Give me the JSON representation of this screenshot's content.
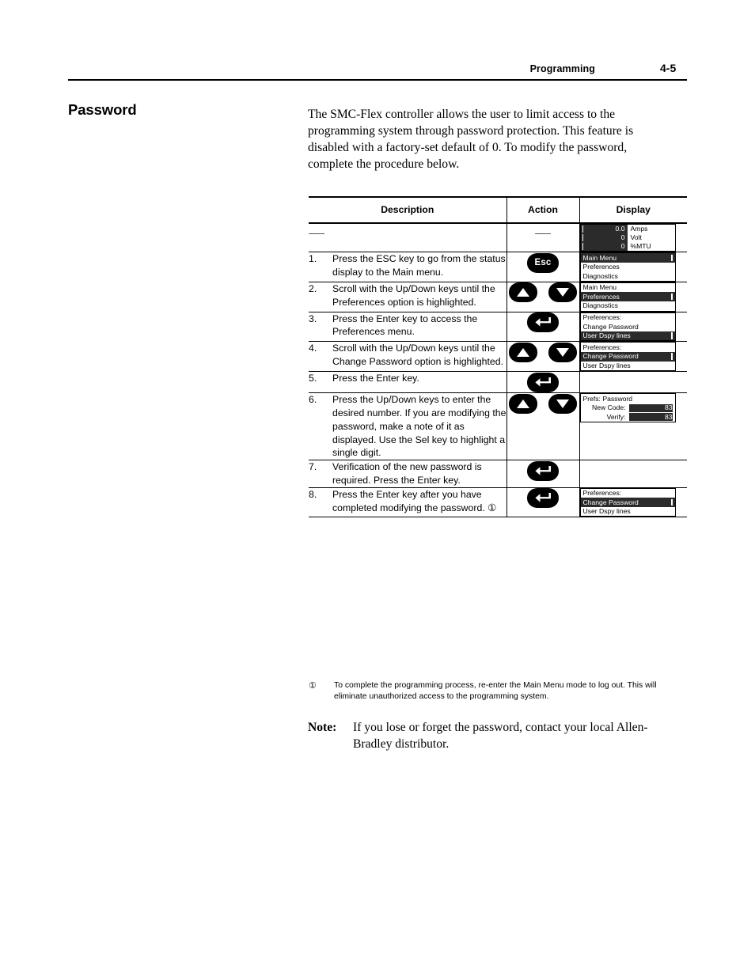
{
  "header": {
    "section": "Programming",
    "page_number": "4-5"
  },
  "section_title": "Password",
  "intro": "The SMC-Flex controller allows the user to limit access to the programming system through password protection. This feature is disabled with a factory-set default of 0. To modify the password, complete the procedure below.",
  "table": {
    "columns": {
      "description": "Description",
      "action": "Action",
      "display": "Display"
    },
    "rows": [
      {
        "num": "",
        "text": "",
        "dash_description": true,
        "dash_action": true,
        "keys": [],
        "display": {
          "type": "meter",
          "rows": [
            {
              "value": "0.0",
              "unit": "Amps"
            },
            {
              "value": "0",
              "unit": "Volt"
            },
            {
              "value": "0",
              "unit": "%MTU"
            }
          ]
        }
      },
      {
        "num": "1.",
        "text": "Press the ESC key to go from the status display to the Main menu.",
        "keys": [
          {
            "type": "esc",
            "label": "Esc"
          }
        ],
        "display": {
          "type": "menu",
          "lines": [
            {
              "text": "Main Menu",
              "highlighted": true
            },
            {
              "text": "Preferences",
              "highlighted": false
            },
            {
              "text": "Diagnostics",
              "highlighted": false
            }
          ]
        }
      },
      {
        "num": "2.",
        "text": "Scroll with the Up/Down keys until the Preferences option is highlighted.",
        "keys": [
          {
            "type": "up"
          },
          {
            "type": "down"
          }
        ],
        "display": {
          "type": "menu",
          "lines": [
            {
              "text": "Main Menu",
              "highlighted": false
            },
            {
              "text": "Preferences",
              "highlighted": true
            },
            {
              "text": "Diagnostics",
              "highlighted": false
            }
          ]
        }
      },
      {
        "num": "3.",
        "text": "Press the Enter key to access the Preferences menu.",
        "keys": [
          {
            "type": "enter"
          }
        ],
        "display": {
          "type": "menu",
          "lines": [
            {
              "text": "Preferences:",
              "highlighted": false
            },
            {
              "text": "Change Password",
              "highlighted": false
            },
            {
              "text": "User Dspy lines",
              "highlighted": true
            }
          ]
        }
      },
      {
        "num": "4.",
        "text": "Scroll with the Up/Down keys until the Change Password option is highlighted.",
        "keys": [
          {
            "type": "up"
          },
          {
            "type": "down"
          }
        ],
        "display": {
          "type": "menu",
          "lines": [
            {
              "text": "Preferences:",
              "highlighted": false
            },
            {
              "text": "Change Password",
              "highlighted": true
            },
            {
              "text": "User Dspy lines",
              "highlighted": false
            }
          ]
        }
      },
      {
        "num": "5.",
        "text": "Press the Enter key.",
        "keys": [
          {
            "type": "enter"
          }
        ],
        "display": {
          "type": "none"
        }
      },
      {
        "num": "6.",
        "text": "Press the Up/Down keys to enter the desired number. If you are modifying the password, make a note of it as displayed. Use the Sel key to highlight a single digit.",
        "keys": [
          {
            "type": "up"
          },
          {
            "type": "down"
          }
        ],
        "display": {
          "type": "password",
          "title": "Prefs: Password",
          "fields": [
            {
              "label": "New Code:",
              "value": "83"
            },
            {
              "label": "Verify:",
              "value": "83"
            }
          ]
        }
      },
      {
        "num": "7.",
        "text": "Verification of the new password is required. Press the Enter key.",
        "keys": [
          {
            "type": "enter"
          }
        ],
        "display": {
          "type": "none"
        }
      },
      {
        "num": "8.",
        "text": "Press the Enter key after you have completed modifying the password. ①",
        "keys": [
          {
            "type": "enter"
          }
        ],
        "display": {
          "type": "menu",
          "lines": [
            {
              "text": "Preferences:",
              "highlighted": false
            },
            {
              "text": "Change Password",
              "highlighted": true
            },
            {
              "text": "User Dspy lines",
              "highlighted": false
            }
          ]
        }
      }
    ]
  },
  "footnote": {
    "mark": "①",
    "text": "To complete the programming process, re-enter the Main Menu mode to log out. This will eliminate unauthorized access to the programming system."
  },
  "note": {
    "label": "Note:",
    "text": "If you lose or forget the password, contact your local Allen-Bradley distributor."
  }
}
